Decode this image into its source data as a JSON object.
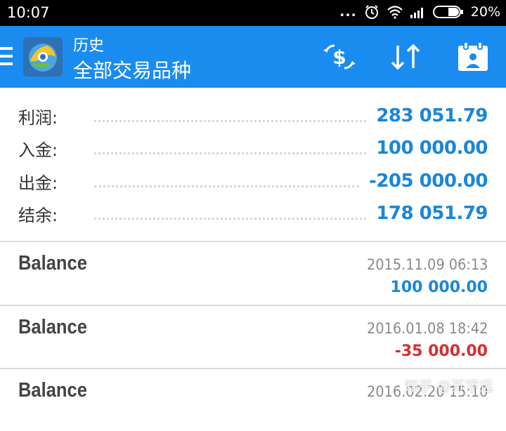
{
  "status_bar": {
    "time": "10:07",
    "dots": "...",
    "battery_percent": "20%",
    "icons": [
      "alarm-icon",
      "wifi-icon",
      "signal-icon",
      "battery-icon"
    ]
  },
  "app_bar": {
    "subtitle": "历史",
    "title": "全部交易品种",
    "background_color": "#1a8cf0",
    "actions": [
      "currency-exchange-icon",
      "sort-icon",
      "calendar-icon"
    ]
  },
  "summary": [
    {
      "label": "利润:",
      "value": "283 051.79"
    },
    {
      "label": "入金:",
      "value": "100 000.00"
    },
    {
      "label": "出金:",
      "value": "-205 000.00"
    },
    {
      "label": "结余:",
      "value": "178 051.79"
    }
  ],
  "entries": [
    {
      "name": "Balance",
      "date": "2015.11.09 06:13",
      "amount": "100 000.00",
      "amount_color": "#1a86d8"
    },
    {
      "name": "Balance",
      "date": "2016.01.08 18:42",
      "amount": "-35 000.00",
      "amount_color": "#d32f2f"
    },
    {
      "name": "Balance",
      "date": "2016.02.20 15:10",
      "amount": "",
      "amount_color": "#1a86d8"
    }
  ],
  "watermark": "知乎 @苏宇远",
  "colors": {
    "positive": "#1a86d8",
    "negative": "#d32f2f"
  }
}
